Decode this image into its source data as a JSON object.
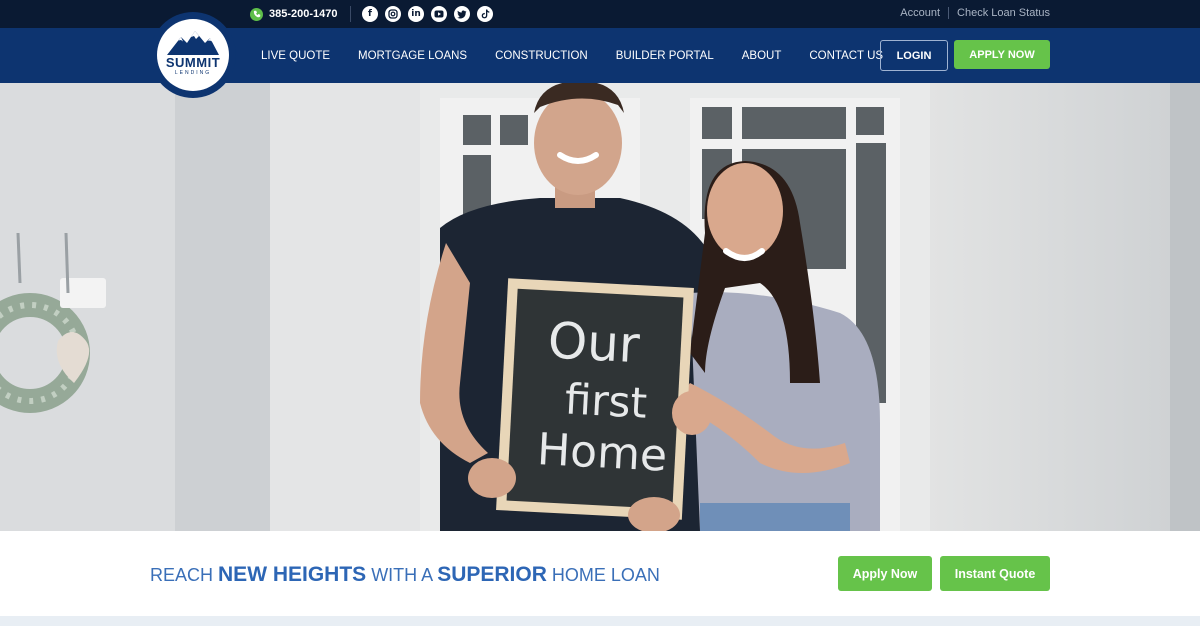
{
  "topbar": {
    "phone": "385-200-1470",
    "socials": [
      "facebook-icon",
      "instagram-icon",
      "linkedin-icon",
      "youtube-icon",
      "twitter-icon",
      "tiktok-icon"
    ],
    "links": [
      "Account",
      "Check Loan Status"
    ]
  },
  "logo": {
    "name": "SUMMIT",
    "sub": "LENDING"
  },
  "nav": {
    "items": [
      "LIVE QUOTE",
      "MORTGAGE LOANS",
      "CONSTRUCTION",
      "BUILDER PORTAL",
      "ABOUT",
      "CONTACT US"
    ],
    "login": "LOGIN",
    "apply": "APPLY NOW"
  },
  "hero": {
    "chalkboard": [
      "Our",
      "first",
      "Home"
    ]
  },
  "tagline": {
    "p1": "REACH ",
    "b1": "NEW HEIGHTS",
    "p2": " WITH A ",
    "b2": "SUPERIOR",
    "p3": " HOME LOAN"
  },
  "cta": {
    "apply": "Apply Now",
    "quote": "Instant Quote"
  },
  "colors": {
    "topbar": "#0a1a33",
    "nav": "#0d3470",
    "accent_green": "#66c34a",
    "tagline_blue": "#2d66b5"
  }
}
